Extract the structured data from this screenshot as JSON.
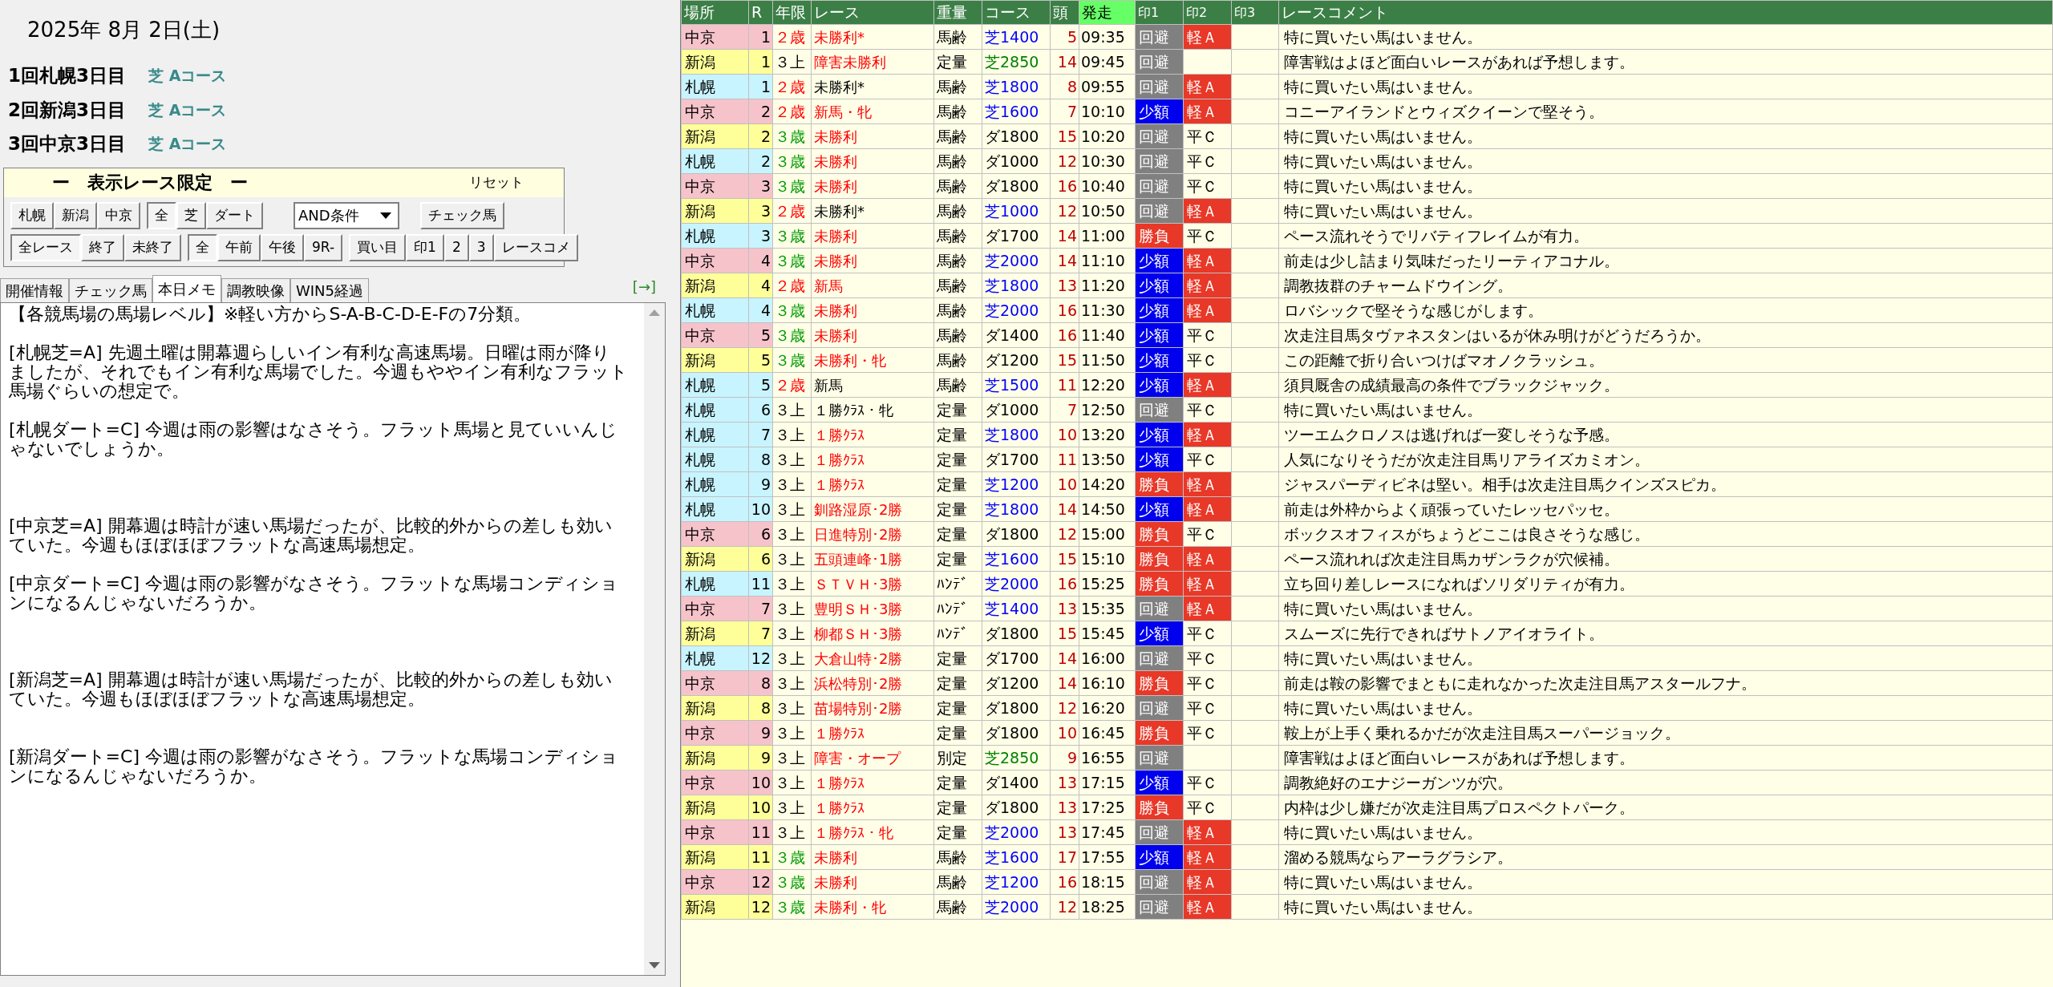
{
  "date": "2025年 8月 2日(土)",
  "meetings": [
    {
      "name": "1回札幌3日目",
      "course": "芝 Aコース"
    },
    {
      "name": "2回新潟3日目",
      "course": "芝 Aコース"
    },
    {
      "name": "3回中京3日目",
      "course": "芝 Aコース"
    }
  ],
  "filter": {
    "title": "ー　表示レース限定　ー",
    "reset": "リセット",
    "dropdown": "AND条件",
    "row_1": [
      [
        {
          "label": "札幌",
          "selected": false
        },
        {
          "label": "新潟",
          "selected": false
        },
        {
          "label": "中京",
          "selected": false
        }
      ],
      [
        {
          "label": "全",
          "selected": true
        },
        {
          "label": "芝",
          "selected": false
        },
        {
          "label": "ダート",
          "selected": false
        }
      ]
    ],
    "check_button": "チェック馬",
    "row_2": [
      [
        {
          "label": "全レース",
          "selected": true
        },
        {
          "label": "終了",
          "selected": false
        },
        {
          "label": "未終了",
          "selected": false
        }
      ],
      [
        {
          "label": "全",
          "selected": true
        },
        {
          "label": "午前",
          "selected": false
        },
        {
          "label": "午後",
          "selected": false
        },
        {
          "label": "9R-",
          "selected": false
        }
      ],
      [
        {
          "label": "買い目",
          "selected": false
        },
        {
          "label": "印1",
          "selected": false
        },
        {
          "label": "2",
          "selected": false
        },
        {
          "label": "3",
          "selected": false
        },
        {
          "label": "レースコメ",
          "selected": false
        }
      ]
    ]
  },
  "tabs": [
    {
      "label": "開催情報",
      "selected": false
    },
    {
      "label": "チェック馬",
      "selected": false
    },
    {
      "label": "本日メモ",
      "selected": true
    },
    {
      "label": "調教映像",
      "selected": false
    },
    {
      "label": "WIN5経過",
      "selected": false
    }
  ],
  "expand_link": "[→]",
  "memo": "【各競馬場の馬場レベル】※軽い方からS-A-B-C-D-E-Fの7分類。\n\n[札幌芝=A] 先週土曜は開幕週らしいイン有利な高速馬場。日曜は雨が降りましたが、それでもイン有利な馬場でした。今週もややイン有利なフラット馬場ぐらいの想定で。\n\n[札幌ダート=C] 今週は雨の影響はなさそう。フラット馬場と見ていいんじゃないでしょうか。\n\n\n\n[中京芝=A] 開幕週は時計が速い馬場だったが、比較的外からの差しも効いていた。今週もほぼほぼフラットな高速馬場想定。\n\n[中京ダート=C] 今週は雨の影響がなさそう。フラットな馬場コンディションになるんじゃないだろうか。\n\n\n\n[新潟芝=A] 開幕週は時計が速い馬場だったが、比較的外からの差しも効いていた。今週もほぼほぼフラットな高速馬場想定。\n\n\n[新潟ダート=C] 今週は雨の影響がなさそう。フラットな馬場コンディションになるんじゃないだろうか。",
  "table": {
    "columns": [
      "場所",
      "R",
      "年限",
      "レース",
      "重量",
      "コース",
      "頭",
      "発走",
      "印1",
      "印2",
      "印3",
      "レースコメント"
    ],
    "rows": [
      {
        "venue": "中京",
        "color": "#f6c3cb",
        "r": "1",
        "age": {
          "text": "２歳",
          "color": "#ff0000"
        },
        "race": {
          "text": "未勝利*",
          "color": "#ff0000"
        },
        "weight": "馬齢",
        "course": {
          "text": "芝1400",
          "color": "#0000ff"
        },
        "heads": "5",
        "start": "09:35",
        "rec1": {
          "text": "回避",
          "kind": "avoid"
        },
        "rec2": {
          "text": "軽Ａ",
          "kind": "light"
        },
        "comment": "特に買いたい馬はいません。"
      },
      {
        "venue": "新潟",
        "color": "#ffff99",
        "r": "1",
        "age": {
          "text": "３上",
          "color": "#000000"
        },
        "race": {
          "text": "障害未勝利",
          "color": "#ff0000"
        },
        "weight": "定量",
        "course": {
          "text": "芝2850",
          "color": "#008000"
        },
        "heads": "14",
        "start": "09:45",
        "rec1": {
          "text": "回避",
          "kind": "avoid"
        },
        "comment": "障害戦はよほど面白いレースがあれば予想します。"
      },
      {
        "venue": "札幌",
        "color": "#c8f4ff",
        "r": "1",
        "age": {
          "text": "２歳",
          "color": "#ff0000"
        },
        "race": {
          "text": "未勝利*",
          "color": "#000000"
        },
        "weight": "馬齢",
        "course": {
          "text": "芝1800",
          "color": "#0000ff"
        },
        "heads": "8",
        "start": "09:55",
        "rec1": {
          "text": "回避",
          "kind": "avoid"
        },
        "rec2": {
          "text": "軽Ａ",
          "kind": "light"
        },
        "comment": "特に買いたい馬はいません。"
      },
      {
        "venue": "中京",
        "color": "#f6c3cb",
        "r": "2",
        "age": {
          "text": "２歳",
          "color": "#ff0000"
        },
        "race": {
          "text": "新馬・牝",
          "color": "#ff0000"
        },
        "weight": "馬齢",
        "course": {
          "text": "芝1600",
          "color": "#0000ff"
        },
        "heads": "7",
        "start": "10:10",
        "rec1": {
          "text": "少額",
          "kind": "small"
        },
        "rec2": {
          "text": "軽Ａ",
          "kind": "light"
        },
        "comment": "コニーアイランドとウィズクイーンで堅そう。"
      },
      {
        "venue": "新潟",
        "color": "#ffff99",
        "r": "2",
        "age": {
          "text": "３歳",
          "color": "#009900"
        },
        "race": {
          "text": "未勝利",
          "color": "#ff0000"
        },
        "weight": "馬齢",
        "course": {
          "text": "ダ1800",
          "color": "#000000"
        },
        "heads": "15",
        "start": "10:20",
        "rec1": {
          "text": "回避",
          "kind": "avoid"
        },
        "rec2": {
          "text": "平Ｃ",
          "kind": "flat"
        },
        "comment": "特に買いたい馬はいません。"
      },
      {
        "venue": "札幌",
        "color": "#c8f4ff",
        "r": "2",
        "age": {
          "text": "３歳",
          "color": "#009900"
        },
        "race": {
          "text": "未勝利",
          "color": "#ff0000"
        },
        "weight": "馬齢",
        "course": {
          "text": "ダ1000",
          "color": "#000000"
        },
        "heads": "12",
        "start": "10:30",
        "rec1": {
          "text": "回避",
          "kind": "avoid"
        },
        "rec2": {
          "text": "平Ｃ",
          "kind": "flat"
        },
        "comment": "特に買いたい馬はいません。"
      },
      {
        "venue": "中京",
        "color": "#f6c3cb",
        "r": "3",
        "age": {
          "text": "３歳",
          "color": "#009900"
        },
        "race": {
          "text": "未勝利",
          "color": "#ff0000"
        },
        "weight": "馬齢",
        "course": {
          "text": "ダ1800",
          "color": "#000000"
        },
        "heads": "16",
        "start": "10:40",
        "rec1": {
          "text": "回避",
          "kind": "avoid"
        },
        "rec2": {
          "text": "平Ｃ",
          "kind": "flat"
        },
        "comment": "特に買いたい馬はいません。"
      },
      {
        "venue": "新潟",
        "color": "#ffff99",
        "r": "3",
        "age": {
          "text": "２歳",
          "color": "#ff0000"
        },
        "race": {
          "text": "未勝利*",
          "color": "#000000"
        },
        "weight": "馬齢",
        "course": {
          "text": "芝1000",
          "color": "#0000ff"
        },
        "heads": "12",
        "start": "10:50",
        "rec1": {
          "text": "回避",
          "kind": "avoid"
        },
        "rec2": {
          "text": "軽Ａ",
          "kind": "light"
        },
        "comment": "特に買いたい馬はいません。"
      },
      {
        "venue": "札幌",
        "color": "#c8f4ff",
        "r": "3",
        "age": {
          "text": "３歳",
          "color": "#009900"
        },
        "race": {
          "text": "未勝利",
          "color": "#ff0000"
        },
        "weight": "馬齢",
        "course": {
          "text": "ダ1700",
          "color": "#000000"
        },
        "heads": "14",
        "start": "11:00",
        "rec1": {
          "text": "勝負",
          "kind": "bet"
        },
        "rec2": {
          "text": "平Ｃ",
          "kind": "flat"
        },
        "comment": "ペース流れそうでリバティフレイムが有力。"
      },
      {
        "venue": "中京",
        "color": "#f6c3cb",
        "r": "4",
        "age": {
          "text": "３歳",
          "color": "#009900"
        },
        "race": {
          "text": "未勝利",
          "color": "#ff0000"
        },
        "weight": "馬齢",
        "course": {
          "text": "芝2000",
          "color": "#0000ff"
        },
        "heads": "14",
        "start": "11:10",
        "rec1": {
          "text": "少額",
          "kind": "small"
        },
        "rec2": {
          "text": "軽Ａ",
          "kind": "light"
        },
        "comment": "前走は少し詰まり気味だったリーティアコナル。"
      },
      {
        "venue": "新潟",
        "color": "#ffff99",
        "r": "4",
        "age": {
          "text": "２歳",
          "color": "#ff0000"
        },
        "race": {
          "text": "新馬",
          "color": "#ff0000"
        },
        "weight": "馬齢",
        "course": {
          "text": "芝1800",
          "color": "#0000ff"
        },
        "heads": "13",
        "start": "11:20",
        "rec1": {
          "text": "少額",
          "kind": "small"
        },
        "rec2": {
          "text": "軽Ａ",
          "kind": "light"
        },
        "comment": "調教抜群のチャームドウイング。"
      },
      {
        "venue": "札幌",
        "color": "#c8f4ff",
        "r": "4",
        "age": {
          "text": "３歳",
          "color": "#009900"
        },
        "race": {
          "text": "未勝利",
          "color": "#ff0000"
        },
        "weight": "馬齢",
        "course": {
          "text": "芝2000",
          "color": "#0000ff"
        },
        "heads": "16",
        "start": "11:30",
        "rec1": {
          "text": "少額",
          "kind": "small"
        },
        "rec2": {
          "text": "軽Ａ",
          "kind": "light"
        },
        "comment": "ロバシックで堅そうな感じがします。"
      },
      {
        "venue": "中京",
        "color": "#f6c3cb",
        "r": "5",
        "age": {
          "text": "３歳",
          "color": "#009900"
        },
        "race": {
          "text": "未勝利",
          "color": "#ff0000"
        },
        "weight": "馬齢",
        "course": {
          "text": "ダ1400",
          "color": "#000000"
        },
        "heads": "16",
        "start": "11:40",
        "rec1": {
          "text": "少額",
          "kind": "small"
        },
        "rec2": {
          "text": "平Ｃ",
          "kind": "flat"
        },
        "comment": "次走注目馬タヴァネスタンはいるが休み明けがどうだろうか。"
      },
      {
        "venue": "新潟",
        "color": "#ffff99",
        "r": "5",
        "age": {
          "text": "３歳",
          "color": "#009900"
        },
        "race": {
          "text": "未勝利・牝",
          "color": "#ff0000"
        },
        "weight": "馬齢",
        "course": {
          "text": "ダ1200",
          "color": "#000000"
        },
        "heads": "15",
        "start": "11:50",
        "rec1": {
          "text": "少額",
          "kind": "small"
        },
        "rec2": {
          "text": "平Ｃ",
          "kind": "flat"
        },
        "comment": "この距離で折り合いつけばマオノクラッシュ。"
      },
      {
        "venue": "札幌",
        "color": "#c8f4ff",
        "r": "5",
        "age": {
          "text": "２歳",
          "color": "#ff0000"
        },
        "race": {
          "text": "新馬",
          "color": "#000000"
        },
        "weight": "馬齢",
        "course": {
          "text": "芝1500",
          "color": "#0000ff"
        },
        "heads": "11",
        "start": "12:20",
        "rec1": {
          "text": "少額",
          "kind": "small"
        },
        "rec2": {
          "text": "軽Ａ",
          "kind": "light"
        },
        "comment": "須貝厩舎の成績最高の条件でブラックジャック。"
      },
      {
        "venue": "札幌",
        "color": "#c8f4ff",
        "r": "6",
        "age": {
          "text": "３上",
          "color": "#000000"
        },
        "race": {
          "text": "１勝ｸﾗｽ・牝",
          "color": "#000000"
        },
        "weight": "定量",
        "course": {
          "text": "ダ1000",
          "color": "#000000"
        },
        "heads": "7",
        "start": "12:50",
        "rec1": {
          "text": "回避",
          "kind": "avoid"
        },
        "rec2": {
          "text": "平Ｃ",
          "kind": "flat"
        },
        "comment": "特に買いたい馬はいません。"
      },
      {
        "venue": "札幌",
        "color": "#c8f4ff",
        "r": "7",
        "age": {
          "text": "３上",
          "color": "#000000"
        },
        "race": {
          "text": "１勝ｸﾗｽ",
          "color": "#ff0000"
        },
        "weight": "定量",
        "course": {
          "text": "芝1800",
          "color": "#0000ff"
        },
        "heads": "10",
        "start": "13:20",
        "rec1": {
          "text": "少額",
          "kind": "small"
        },
        "rec2": {
          "text": "軽Ａ",
          "kind": "light"
        },
        "comment": "ツーエムクロノスは逃げれば一変しそうな予感。"
      },
      {
        "venue": "札幌",
        "color": "#c8f4ff",
        "r": "8",
        "age": {
          "text": "３上",
          "color": "#000000"
        },
        "race": {
          "text": "１勝ｸﾗｽ",
          "color": "#ff0000"
        },
        "weight": "定量",
        "course": {
          "text": "ダ1700",
          "color": "#000000"
        },
        "heads": "11",
        "start": "13:50",
        "rec1": {
          "text": "少額",
          "kind": "small"
        },
        "rec2": {
          "text": "平Ｃ",
          "kind": "flat"
        },
        "comment": "人気になりそうだが次走注目馬リアライズカミオン。"
      },
      {
        "venue": "札幌",
        "color": "#c8f4ff",
        "r": "9",
        "age": {
          "text": "３上",
          "color": "#000000"
        },
        "race": {
          "text": "１勝ｸﾗｽ",
          "color": "#ff0000"
        },
        "weight": "定量",
        "course": {
          "text": "芝1200",
          "color": "#0000ff"
        },
        "heads": "10",
        "start": "14:20",
        "rec1": {
          "text": "勝負",
          "kind": "bet"
        },
        "rec2": {
          "text": "軽Ａ",
          "kind": "light"
        },
        "comment": "ジャスパーディビネは堅い。相手は次走注目馬クインズスピカ。"
      },
      {
        "venue": "札幌",
        "color": "#c8f4ff",
        "r": "10",
        "age": {
          "text": "３上",
          "color": "#000000"
        },
        "race": {
          "text": "釧路湿原･2勝",
          "color": "#ff0000"
        },
        "weight": "定量",
        "course": {
          "text": "芝1800",
          "color": "#0000ff"
        },
        "heads": "14",
        "start": "14:50",
        "rec1": {
          "text": "少額",
          "kind": "small"
        },
        "rec2": {
          "text": "軽Ａ",
          "kind": "light"
        },
        "comment": "前走は外枠からよく頑張っていたレッセパッセ。"
      },
      {
        "venue": "中京",
        "color": "#f6c3cb",
        "r": "6",
        "age": {
          "text": "３上",
          "color": "#000000"
        },
        "race": {
          "text": "日進特別･2勝",
          "color": "#ff0000"
        },
        "weight": "定量",
        "course": {
          "text": "ダ1800",
          "color": "#000000"
        },
        "heads": "12",
        "start": "15:00",
        "rec1": {
          "text": "勝負",
          "kind": "bet"
        },
        "rec2": {
          "text": "平Ｃ",
          "kind": "flat"
        },
        "comment": "ボックスオフィスがちょうどここは良さそうな感じ。"
      },
      {
        "venue": "新潟",
        "color": "#ffff99",
        "r": "6",
        "age": {
          "text": "３上",
          "color": "#000000"
        },
        "race": {
          "text": "五頭連峰･1勝",
          "color": "#ff0000"
        },
        "weight": "定量",
        "course": {
          "text": "芝1600",
          "color": "#0000ff"
        },
        "heads": "15",
        "start": "15:10",
        "rec1": {
          "text": "勝負",
          "kind": "bet"
        },
        "rec2": {
          "text": "軽Ａ",
          "kind": "light"
        },
        "comment": "ペース流れれば次走注目馬カザンラクが穴候補。"
      },
      {
        "venue": "札幌",
        "color": "#c8f4ff",
        "r": "11",
        "age": {
          "text": "３上",
          "color": "#000000"
        },
        "race": {
          "text": "ＳＴＶＨ･3勝",
          "color": "#ff0000"
        },
        "weight": "ﾊﾝﾃﾞ",
        "course": {
          "text": "芝2000",
          "color": "#0000ff"
        },
        "heads": "16",
        "start": "15:25",
        "rec1": {
          "text": "勝負",
          "kind": "bet"
        },
        "rec2": {
          "text": "軽Ａ",
          "kind": "light"
        },
        "comment": "立ち回り差しレースになればソリダリティが有力。"
      },
      {
        "venue": "中京",
        "color": "#f6c3cb",
        "r": "7",
        "age": {
          "text": "３上",
          "color": "#000000"
        },
        "race": {
          "text": "豊明ＳＨ･3勝",
          "color": "#ff0000"
        },
        "weight": "ﾊﾝﾃﾞ",
        "course": {
          "text": "芝1400",
          "color": "#0000ff"
        },
        "heads": "13",
        "start": "15:35",
        "rec1": {
          "text": "回避",
          "kind": "avoid"
        },
        "rec2": {
          "text": "軽Ａ",
          "kind": "light"
        },
        "comment": "特に買いたい馬はいません。"
      },
      {
        "venue": "新潟",
        "color": "#ffff99",
        "r": "7",
        "age": {
          "text": "３上",
          "color": "#000000"
        },
        "race": {
          "text": "柳都ＳＨ･3勝",
          "color": "#ff0000"
        },
        "weight": "ﾊﾝﾃﾞ",
        "course": {
          "text": "ダ1800",
          "color": "#000000"
        },
        "heads": "15",
        "start": "15:45",
        "rec1": {
          "text": "少額",
          "kind": "small"
        },
        "rec2": {
          "text": "平Ｃ",
          "kind": "flat"
        },
        "comment": "スムーズに先行できればサトノアイオライト。"
      },
      {
        "venue": "札幌",
        "color": "#c8f4ff",
        "r": "12",
        "age": {
          "text": "３上",
          "color": "#000000"
        },
        "race": {
          "text": "大倉山特･2勝",
          "color": "#ff0000"
        },
        "weight": "定量",
        "course": {
          "text": "ダ1700",
          "color": "#000000"
        },
        "heads": "14",
        "start": "16:00",
        "rec1": {
          "text": "回避",
          "kind": "avoid"
        },
        "rec2": {
          "text": "平Ｃ",
          "kind": "flat"
        },
        "comment": "特に買いたい馬はいません。"
      },
      {
        "venue": "中京",
        "color": "#f6c3cb",
        "r": "8",
        "age": {
          "text": "３上",
          "color": "#000000"
        },
        "race": {
          "text": "浜松特別･2勝",
          "color": "#ff0000"
        },
        "weight": "定量",
        "course": {
          "text": "ダ1200",
          "color": "#000000"
        },
        "heads": "14",
        "start": "16:10",
        "rec1": {
          "text": "勝負",
          "kind": "bet"
        },
        "rec2": {
          "text": "平Ｃ",
          "kind": "flat"
        },
        "comment": "前走は鞍の影響でまともに走れなかった次走注目馬アスタールフナ。"
      },
      {
        "venue": "新潟",
        "color": "#ffff99",
        "r": "8",
        "age": {
          "text": "３上",
          "color": "#000000"
        },
        "race": {
          "text": "苗場特別･2勝",
          "color": "#ff0000"
        },
        "weight": "定量",
        "course": {
          "text": "ダ1800",
          "color": "#000000"
        },
        "heads": "12",
        "start": "16:20",
        "rec1": {
          "text": "回避",
          "kind": "avoid"
        },
        "rec2": {
          "text": "平Ｃ",
          "kind": "flat"
        },
        "comment": "特に買いたい馬はいません。"
      },
      {
        "venue": "中京",
        "color": "#f6c3cb",
        "r": "9",
        "age": {
          "text": "３上",
          "color": "#000000"
        },
        "race": {
          "text": "１勝ｸﾗｽ",
          "color": "#ff0000"
        },
        "weight": "定量",
        "course": {
          "text": "ダ1800",
          "color": "#000000"
        },
        "heads": "10",
        "start": "16:45",
        "rec1": {
          "text": "勝負",
          "kind": "bet"
        },
        "rec2": {
          "text": "平Ｃ",
          "kind": "flat"
        },
        "comment": "鞍上が上手く乗れるかだが次走注目馬スーパージョック。"
      },
      {
        "venue": "新潟",
        "color": "#ffff99",
        "r": "9",
        "age": {
          "text": "３上",
          "color": "#000000"
        },
        "race": {
          "text": "障害・オープ",
          "color": "#ff0000"
        },
        "weight": "別定",
        "course": {
          "text": "芝2850",
          "color": "#008000"
        },
        "heads": "9",
        "start": "16:55",
        "rec1": {
          "text": "回避",
          "kind": "avoid"
        },
        "comment": "障害戦はよほど面白いレースがあれば予想します。"
      },
      {
        "venue": "中京",
        "color": "#f6c3cb",
        "r": "10",
        "age": {
          "text": "３上",
          "color": "#000000"
        },
        "race": {
          "text": "１勝ｸﾗｽ",
          "color": "#ff0000"
        },
        "weight": "定量",
        "course": {
          "text": "ダ1400",
          "color": "#000000"
        },
        "heads": "13",
        "start": "17:15",
        "rec1": {
          "text": "少額",
          "kind": "small"
        },
        "rec2": {
          "text": "平Ｃ",
          "kind": "flat"
        },
        "comment": "調教絶好のエナジーガンツが穴。"
      },
      {
        "venue": "新潟",
        "color": "#ffff99",
        "r": "10",
        "age": {
          "text": "３上",
          "color": "#000000"
        },
        "race": {
          "text": "１勝ｸﾗｽ",
          "color": "#ff0000"
        },
        "weight": "定量",
        "course": {
          "text": "ダ1800",
          "color": "#000000"
        },
        "heads": "13",
        "start": "17:25",
        "rec1": {
          "text": "勝負",
          "kind": "bet"
        },
        "rec2": {
          "text": "平Ｃ",
          "kind": "flat"
        },
        "comment": "内枠は少し嫌だが次走注目馬プロスペクトパーク。"
      },
      {
        "venue": "中京",
        "color": "#f6c3cb",
        "r": "11",
        "age": {
          "text": "３上",
          "color": "#000000"
        },
        "race": {
          "text": "１勝ｸﾗｽ・牝",
          "color": "#ff0000"
        },
        "weight": "定量",
        "course": {
          "text": "芝2000",
          "color": "#0000ff"
        },
        "heads": "13",
        "start": "17:45",
        "rec1": {
          "text": "回避",
          "kind": "avoid"
        },
        "rec2": {
          "text": "軽Ａ",
          "kind": "light"
        },
        "comment": "特に買いたい馬はいません。"
      },
      {
        "venue": "新潟",
        "color": "#ffff99",
        "r": "11",
        "age": {
          "text": "３歳",
          "color": "#009900"
        },
        "race": {
          "text": "未勝利",
          "color": "#ff0000"
        },
        "weight": "馬齢",
        "course": {
          "text": "芝1600",
          "color": "#0000ff"
        },
        "heads": "17",
        "start": "17:55",
        "rec1": {
          "text": "少額",
          "kind": "small"
        },
        "rec2": {
          "text": "軽Ａ",
          "kind": "light"
        },
        "comment": "溜める競馬ならアーラグラシア。"
      },
      {
        "venue": "中京",
        "color": "#f6c3cb",
        "r": "12",
        "age": {
          "text": "３歳",
          "color": "#009900"
        },
        "race": {
          "text": "未勝利",
          "color": "#ff0000"
        },
        "weight": "馬齢",
        "course": {
          "text": "芝1200",
          "color": "#0000ff"
        },
        "heads": "16",
        "start": "18:15",
        "rec1": {
          "text": "回避",
          "kind": "avoid"
        },
        "rec2": {
          "text": "軽Ａ",
          "kind": "light"
        },
        "comment": "特に買いたい馬はいません。"
      },
      {
        "venue": "新潟",
        "color": "#ffff99",
        "r": "12",
        "age": {
          "text": "３歳",
          "color": "#009900"
        },
        "race": {
          "text": "未勝利・牝",
          "color": "#ff0000"
        },
        "weight": "馬齢",
        "course": {
          "text": "芝2000",
          "color": "#0000ff"
        },
        "heads": "12",
        "start": "18:25",
        "rec1": {
          "text": "回避",
          "kind": "avoid"
        },
        "rec2": {
          "text": "軽Ａ",
          "kind": "light"
        },
        "comment": "特に買いたい馬はいません。"
      }
    ]
  }
}
